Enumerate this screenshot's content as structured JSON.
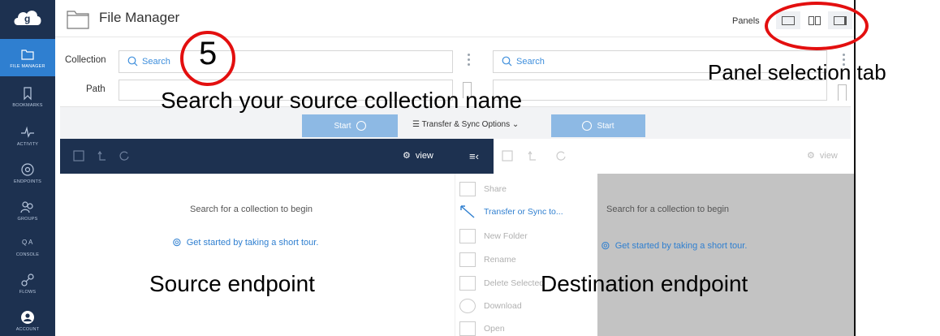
{
  "app": {
    "title": "File Manager"
  },
  "sidebar": {
    "items": [
      {
        "label": "FILE MANAGER",
        "icon": "folder-icon",
        "active": true
      },
      {
        "label": "BOOKMARKS",
        "icon": "bookmark-icon"
      },
      {
        "label": "ACTIVITY",
        "icon": "activity-icon"
      },
      {
        "label": "ENDPOINTS",
        "icon": "endpoints-icon"
      },
      {
        "label": "GROUPS",
        "icon": "groups-icon"
      },
      {
        "label": "CONSOLE",
        "icon": "console-icon"
      },
      {
        "label": "FLOWS",
        "icon": "flows-icon"
      },
      {
        "label": "ACCOUNT",
        "icon": "account-icon"
      }
    ]
  },
  "header": {
    "panels_label": "Panels"
  },
  "form": {
    "collection_label": "Collection",
    "path_label": "Path",
    "left_search_placeholder": "Search",
    "right_search_placeholder": "Search"
  },
  "transfer_bar": {
    "start_left": "Start",
    "options": "Transfer & Sync Options",
    "start_right": "Start"
  },
  "toolbar": {
    "view_left": "view",
    "view_right": "view",
    "menu_toggle": "≡‹"
  },
  "left_pane": {
    "hint": "Search for a collection to begin",
    "tour": "Get started by taking a short tour."
  },
  "right_pane": {
    "hint": "Search for a collection to begin",
    "tour": "Get started by taking a short tour."
  },
  "context_menu": [
    {
      "label": "Share",
      "icon": "share-icon",
      "enabled": false
    },
    {
      "label": "Transfer or Sync to...",
      "icon": "transfer-icon",
      "enabled": true
    },
    {
      "label": "New Folder",
      "icon": "new-folder-icon",
      "enabled": false
    },
    {
      "label": "Rename",
      "icon": "rename-icon",
      "enabled": false
    },
    {
      "label": "Delete Selected",
      "icon": "delete-icon",
      "enabled": false
    },
    {
      "label": "Download",
      "icon": "download-icon",
      "enabled": false
    },
    {
      "label": "Open",
      "icon": "open-icon",
      "enabled": false
    }
  ],
  "annotations": {
    "step_number": "5",
    "search_hint": "Search your source collection name",
    "panel_tab": "Panel selection tab",
    "source": "Source endpoint",
    "destination": "Destination endpoint"
  },
  "colors": {
    "sidebar": "#1d3150",
    "accent": "#2f7fd0",
    "annotation_red": "#e30f0f"
  }
}
